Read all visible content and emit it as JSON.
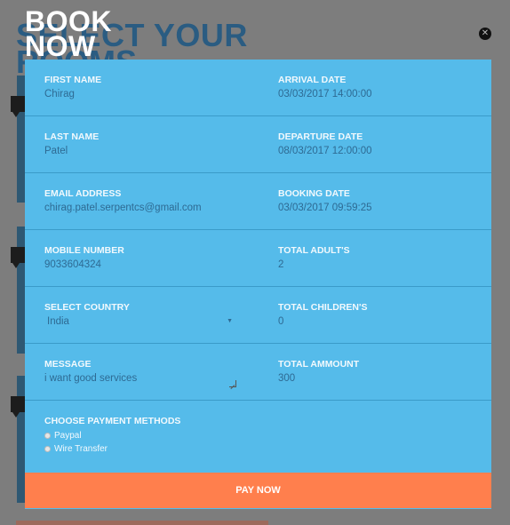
{
  "background": {
    "heading_line1": "SELECT YOUR",
    "heading_line2": "ROOMS"
  },
  "modal": {
    "title_line1": "BOOK",
    "title_line2": "NOW",
    "close_icon": "x-circle-icon",
    "fields": {
      "first_name": {
        "label": "FIRST NAME",
        "value": "Chirag"
      },
      "arrival_date": {
        "label": "ARRIVAL DATE",
        "value": "03/03/2017 14:00:00"
      },
      "last_name": {
        "label": "LAST NAME",
        "value": "Patel"
      },
      "departure_date": {
        "label": "DEPARTURE DATE",
        "value": "08/03/2017 12:00:00"
      },
      "email": {
        "label": "EMAIL ADDRESS",
        "value": "chirag.patel.serpentcs@gmail.com"
      },
      "booking_date": {
        "label": "BOOKING DATE",
        "value": "03/03/2017 09:59:25"
      },
      "mobile": {
        "label": "MOBILE NUMBER",
        "value": "9033604324"
      },
      "total_adults": {
        "label": "TOTAL ADULT'S",
        "value": "2"
      },
      "country": {
        "label": "SELECT COUNTRY",
        "value": "India"
      },
      "total_children": {
        "label": "TOTAL CHILDREN'S",
        "value": "0"
      },
      "message": {
        "label": "MESSAGE",
        "value": "i want good services"
      },
      "total_amount": {
        "label": "TOTAL AMMOUNT",
        "value": "300"
      }
    },
    "payment": {
      "label": "CHOOSE PAYMENT METHODS",
      "options": [
        "Paypal",
        "Wire Transfer"
      ]
    },
    "pay_button": "PAY NOW"
  }
}
